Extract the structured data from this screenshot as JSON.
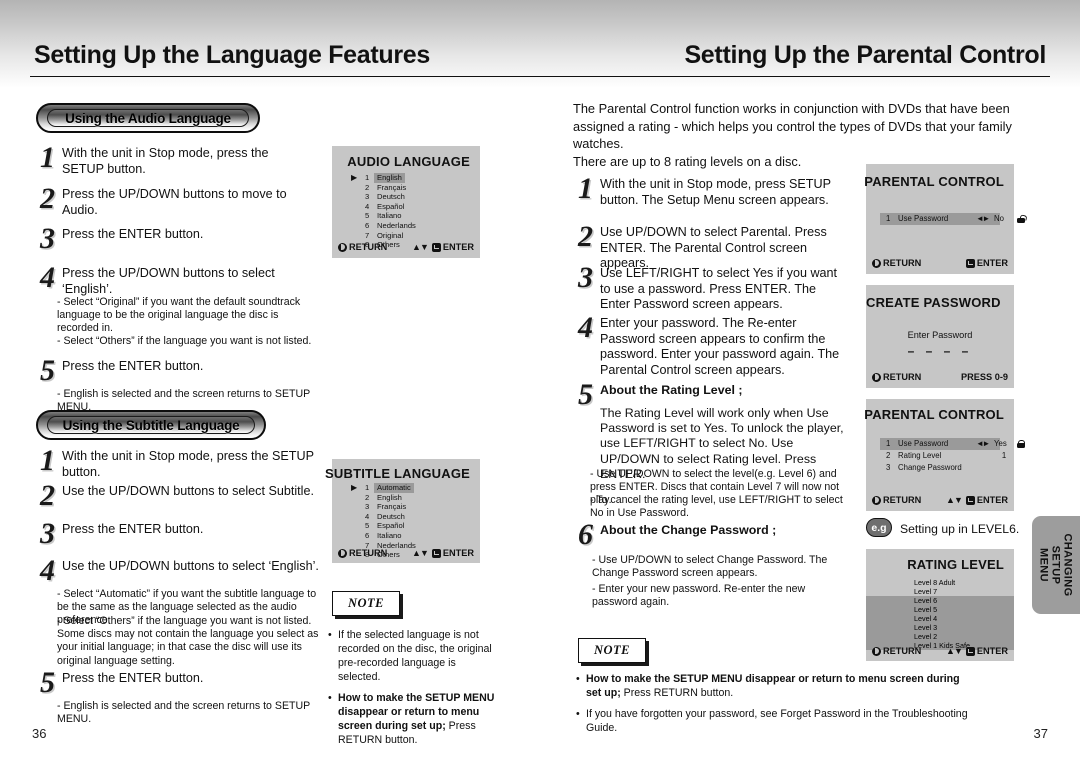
{
  "left_page": {
    "title": "Setting Up the Language Features",
    "page_number": "36",
    "audio_section": {
      "pill_label": "Using the Audio Language",
      "steps": [
        {
          "num": "1",
          "text": "With the unit in Stop mode, press the SETUP button."
        },
        {
          "num": "2",
          "text": "Press the UP/DOWN buttons to move to Audio."
        },
        {
          "num": "3",
          "text": "Press the ENTER button."
        },
        {
          "num": "4",
          "text": "Press the UP/DOWN buttons to select ‘English’."
        },
        {
          "num": "5",
          "text": "Press the ENTER button."
        }
      ],
      "notes_after_4": [
        "- Select “Original” if you want the default soundtrack language to be the original language the disc is recorded in.",
        "- Select “Others” if the language you want is not listed."
      ],
      "note_after_5": "- English is selected and the screen returns to SETUP MENU."
    },
    "subtitle_section": {
      "pill_label": "Using the Subtitle Language",
      "steps": [
        {
          "num": "1",
          "text": "With the unit in Stop mode, press the SETUP button."
        },
        {
          "num": "2",
          "text": "Use the UP/DOWN buttons to select Subtitle."
        },
        {
          "num": "3",
          "text": "Press the ENTER button."
        },
        {
          "num": "4",
          "text": "Use the UP/DOWN buttons to select ‘English’."
        },
        {
          "num": "5",
          "text": "Press the ENTER button."
        }
      ],
      "notes_after_4": [
        "- Select “Automatic” if you want the subtitle language to be the same as the language selected as the audio preference.",
        "- Select “Others” if the language you want is not listed. Some discs may not contain the language you  select as your initial language; in that case the disc will use its original language setting."
      ],
      "note_after_5": "- English is selected and the screen returns to SETUP MENU."
    },
    "audio_osd": {
      "title": "AUDIO LANGUAGE",
      "items": [
        {
          "index": "1",
          "label": "English",
          "selected": true
        },
        {
          "index": "2",
          "label": "Français",
          "selected": false
        },
        {
          "index": "3",
          "label": "Deutsch",
          "selected": false
        },
        {
          "index": "4",
          "label": "Español",
          "selected": false
        },
        {
          "index": "5",
          "label": "Italiano",
          "selected": false
        },
        {
          "index": "6",
          "label": "Nederlands",
          "selected": false
        },
        {
          "index": "7",
          "label": "Original",
          "selected": false
        },
        {
          "index": "8",
          "label": "Others",
          "selected": false
        }
      ],
      "return_label": "RETURN",
      "enter_label": "ENTER"
    },
    "subtitle_osd": {
      "title": "SUBTITLE LANGUAGE",
      "items": [
        {
          "index": "1",
          "label": "Automatic",
          "selected": true
        },
        {
          "index": "2",
          "label": "English",
          "selected": false
        },
        {
          "index": "3",
          "label": "Français",
          "selected": false
        },
        {
          "index": "4",
          "label": "Deutsch",
          "selected": false
        },
        {
          "index": "5",
          "label": "Español",
          "selected": false
        },
        {
          "index": "6",
          "label": "Italiano",
          "selected": false
        },
        {
          "index": "7",
          "label": "Nederlands",
          "selected": false
        },
        {
          "index": "8",
          "label": "Others",
          "selected": false
        }
      ],
      "return_label": "RETURN",
      "enter_label": "ENTER"
    },
    "note": {
      "heading": "NOTE",
      "items": [
        {
          "plain": "If the selected language is not recorded on the disc, the original pre-recorded language is selected."
        },
        {
          "bold_lead": "How to make the SETUP MENU disappear or return to menu screen during set up;",
          "plain": " Press RETURN button."
        }
      ]
    }
  },
  "right_page": {
    "title": "Setting Up the Parental Control",
    "page_number": "37",
    "intro": "The Parental Control function works in conjunction with DVDs that have been assigned a rating - which helps you control the types of DVDs that your family watches.\nThere are up to 8 rating levels on a disc.",
    "steps": [
      {
        "num": "1",
        "text": "With the unit in Stop mode, press SETUP button. The Setup Menu screen appears."
      },
      {
        "num": "2",
        "text": "Use UP/DOWN to select Parental. Press ENTER. The Parental Control screen appears."
      },
      {
        "num": "3",
        "text": "Use LEFT/RIGHT to select Yes if you want to use a password. Press ENTER. The Enter Password screen appears."
      },
      {
        "num": "4",
        "text": "Enter your password. The Re-enter Password screen appears to confirm the password. Enter your password again. The Parental Control screen appears."
      },
      {
        "num": "5",
        "text": "About the Rating Level ;"
      },
      {
        "num": "6",
        "text": "About the Change Password ;"
      }
    ],
    "step5_body": "The Rating Level will work only when Use Password is set to Yes. To unlock the player, use LEFT/RIGHT to select No. Use UP/DOWN to select Rating level. Press ENTER.",
    "step5_notes": [
      "- Use UP/DOWN to select the level(e.g. Level 6) and press ENTER. Discs that contain Level 7 will now not play.",
      "- To cancel the rating level, use LEFT/RIGHT to select No in Use Password."
    ],
    "step6_notes": [
      "- Use UP/DOWN to select Change Password. The Change Password screen appears.",
      "- Enter your new password. Re-enter the new password again."
    ],
    "parental_osd_1": {
      "title": "PARENTAL CONTROL",
      "rows": [
        {
          "index": "1",
          "label": "Use Password",
          "arrows": "◄►",
          "value": "No",
          "icon": "unlock-icon",
          "selected": true
        }
      ],
      "return_label": "RETURN",
      "enter_label": "ENTER"
    },
    "create_password_osd": {
      "title": "CREATE PASSWORD",
      "prompt": "Enter Password",
      "dashes": "– – – –",
      "return_label": "RETURN",
      "press_label": "PRESS 0-9"
    },
    "parental_osd_2": {
      "title": "PARENTAL CONTROL",
      "rows": [
        {
          "index": "1",
          "label": "Use Password",
          "arrows": "◄►",
          "value": "Yes",
          "icon": "lock-icon",
          "selected": true
        },
        {
          "index": "2",
          "label": "Rating Level",
          "arrows": "",
          "value": "1",
          "icon": "",
          "selected": false
        },
        {
          "index": "3",
          "label": "Change Password",
          "arrows": "",
          "value": "",
          "icon": "",
          "selected": false
        }
      ],
      "return_label": "RETURN",
      "enter_label": "ENTER"
    },
    "eg": {
      "badge": "e.g",
      "text": "Setting up in LEVEL6."
    },
    "rating_osd": {
      "title": "RATING  LEVEL",
      "levels": [
        {
          "label": "Level 8 Adult",
          "highlighted": false
        },
        {
          "label": "Level 7",
          "highlighted": false
        },
        {
          "label": "Level 6",
          "highlighted": true
        },
        {
          "label": "Level 5",
          "highlighted": true
        },
        {
          "label": "Level 4",
          "highlighted": true
        },
        {
          "label": "Level 3",
          "highlighted": true
        },
        {
          "label": "Level 2",
          "highlighted": true
        },
        {
          "label": "Level 1 Kids Safe",
          "highlighted": true
        }
      ],
      "return_label": "RETURN",
      "enter_label": "ENTER"
    },
    "note": {
      "heading": "NOTE",
      "items": [
        {
          "bold_lead": "How to make the SETUP MENU disappear or return to menu screen during set up;",
          "plain": " Press RETURN button."
        },
        {
          "plain": "If you have forgotten your password, see Forget Password in the Troubleshooting Guide."
        }
      ]
    },
    "side_tab": "CHANGING\nSETUP MENU"
  }
}
